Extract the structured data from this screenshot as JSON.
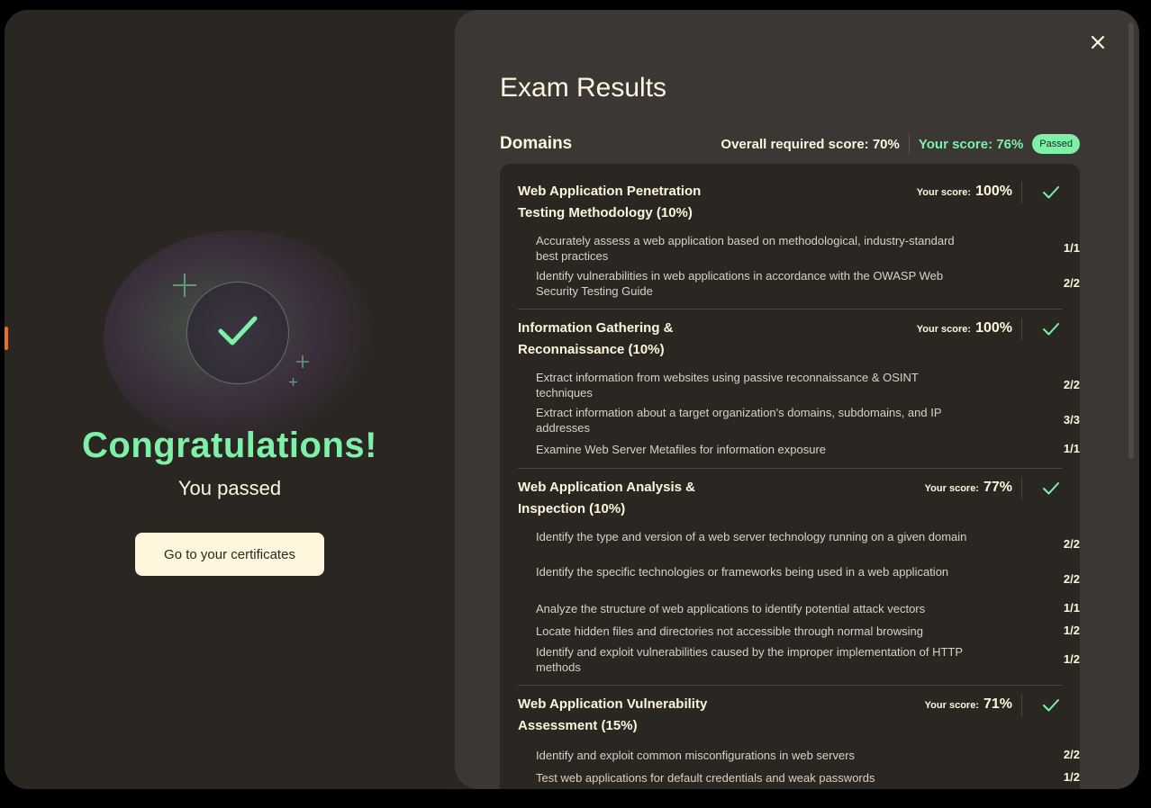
{
  "left": {
    "heading": "Congratulations!",
    "subheading": "You passed",
    "cert_button": "Go to your certificates"
  },
  "right": {
    "title": "Exam Results",
    "domains_label": "Domains",
    "required_score": "Overall required score: 70%",
    "your_score": "Your score: 76%",
    "passed_badge": "Passed",
    "score_label": "Your score:",
    "domains": [
      {
        "title": "Web Application Penetration Testing Methodology (10%)",
        "score": "100%",
        "objectives": [
          {
            "text": "Accurately assess a web application based on methodological, industry-standard best practices",
            "score": "1/1"
          },
          {
            "text": "Identify vulnerabilities in web applications in accordance with the OWASP Web Security Testing Guide",
            "score": "2/2"
          }
        ]
      },
      {
        "title": "Information Gathering & Reconnaissance (10%)",
        "score": "100%",
        "objectives": [
          {
            "text": "Extract information from websites using passive reconnaissance & OSINT techniques",
            "score": "2/2"
          },
          {
            "text": "Extract information about a target organization's domains, subdomains, and IP addresses",
            "score": "3/3"
          },
          {
            "text": "Examine Web Server Metafiles for information exposure",
            "score": "1/1"
          }
        ]
      },
      {
        "title": "Web Application Analysis & Inspection (10%)",
        "score": "77%",
        "objectives": [
          {
            "text": "Identify the type and version of a web server technology running on a given domain",
            "score": "2/2"
          },
          {
            "text": "Identify the specific technologies or frameworks being used in a web application",
            "score": "2/2"
          },
          {
            "text": "Analyze the structure of web applications to identify potential attack vectors",
            "score": "1/1"
          },
          {
            "text": "Locate hidden files and directories not accessible through normal browsing",
            "score": "1/2"
          },
          {
            "text": "Identify and exploit vulnerabilities caused by the improper implementation of HTTP methods",
            "score": "1/2"
          }
        ]
      },
      {
        "title": "Web Application Vulnerability Assessment (15%)",
        "score": "71%",
        "objectives": [
          {
            "text": "Identify and exploit common misconfigurations in web servers",
            "score": "2/2"
          },
          {
            "text": "Test web applications for default credentials and weak passwords",
            "score": "1/2"
          }
        ]
      }
    ]
  },
  "colors": {
    "accent_green": "#7ef0a8",
    "cream": "#fdf6dc",
    "bg_dark": "#2a2723",
    "panel": "#3a3734"
  },
  "icons": [
    "check-icon",
    "close-icon",
    "plus-icon"
  ]
}
